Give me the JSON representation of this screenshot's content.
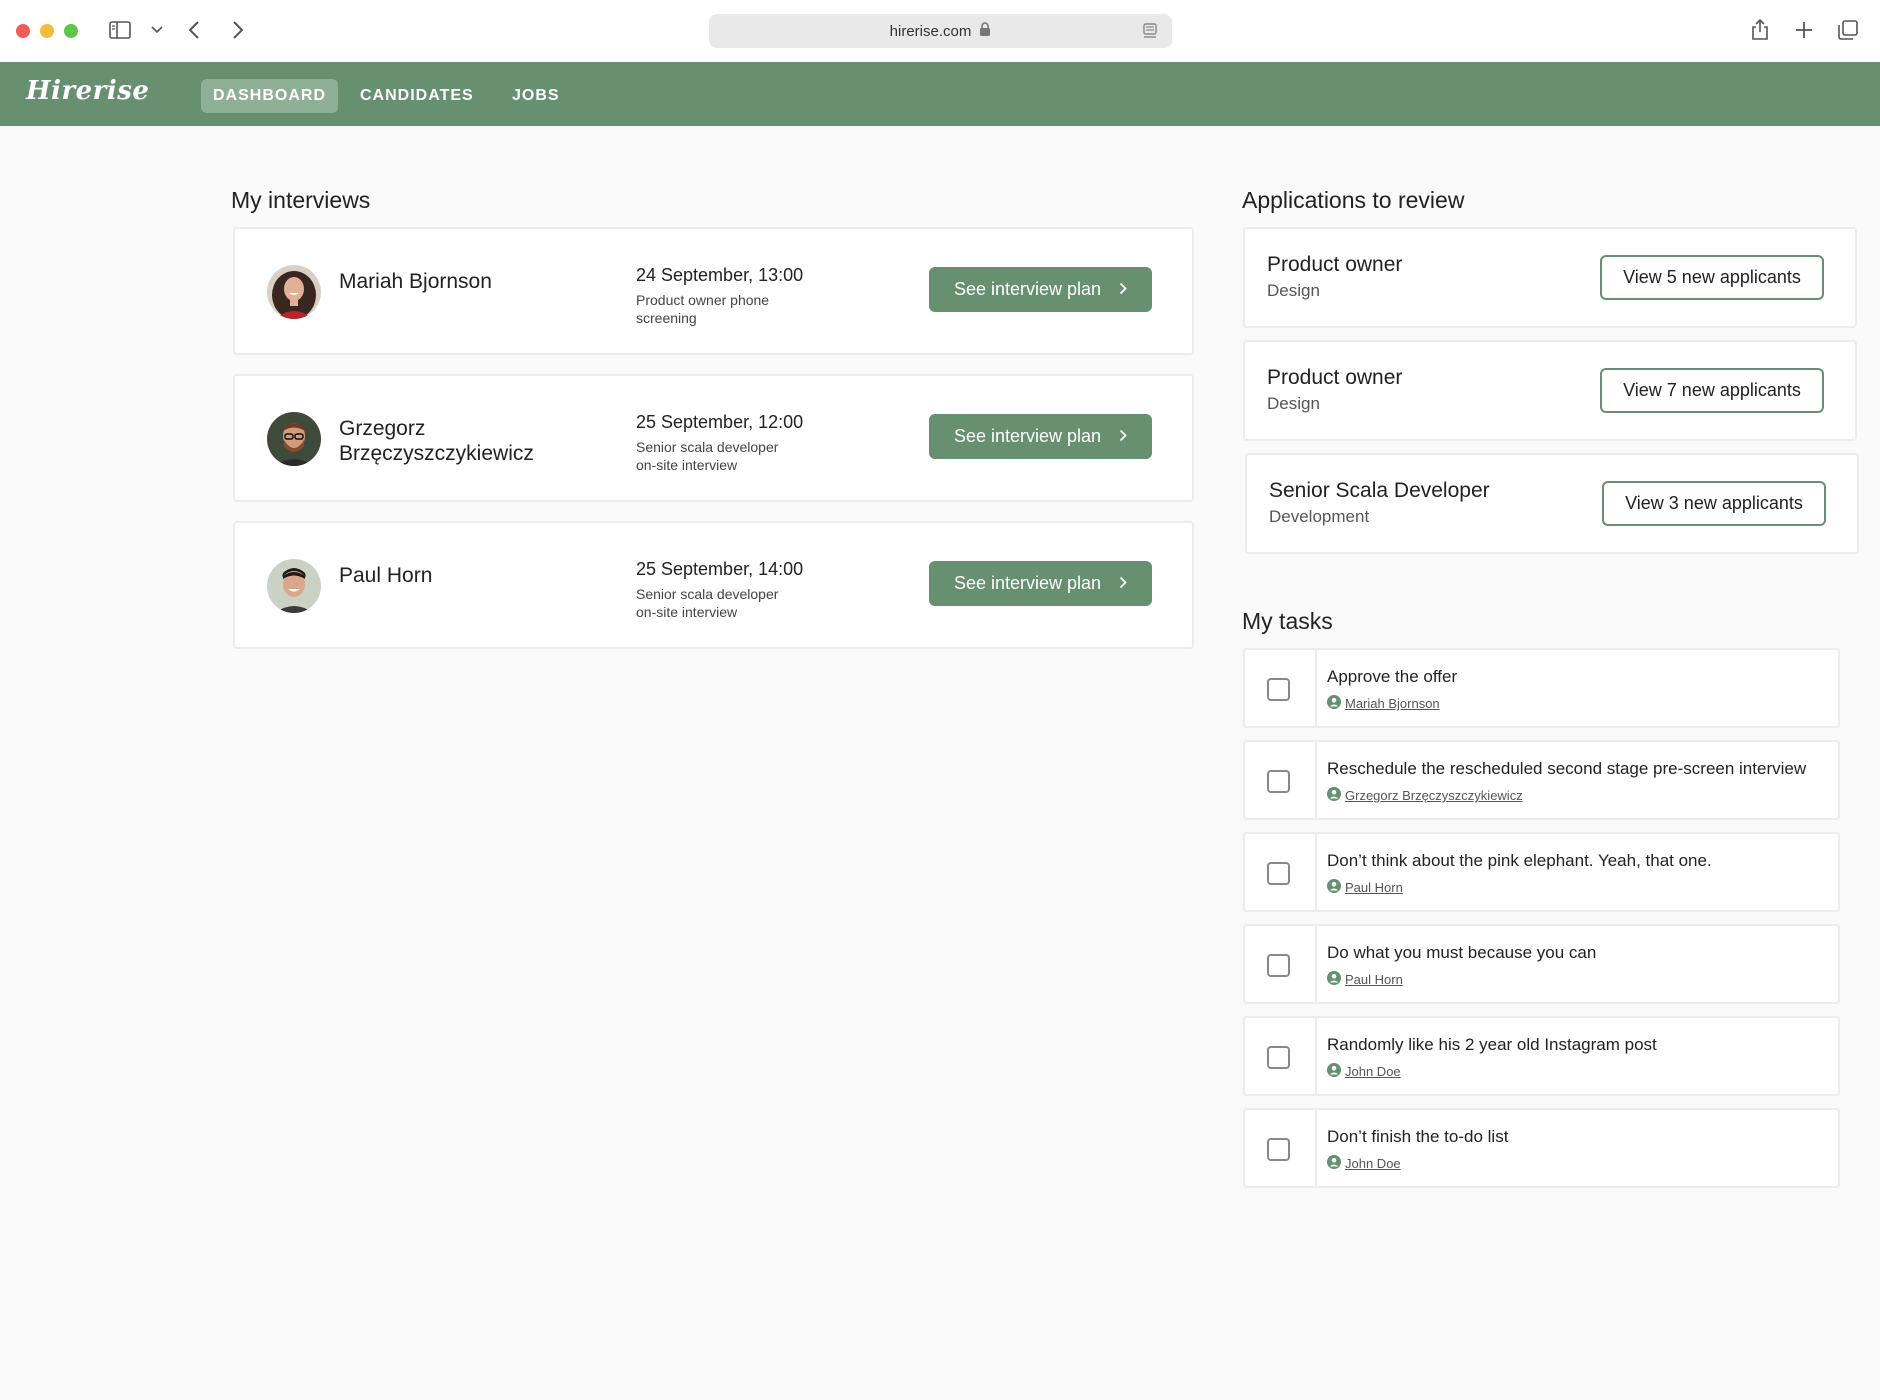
{
  "browser": {
    "url": "hirerise.com"
  },
  "app": {
    "logo": "Hirerise",
    "nav": {
      "dashboard": "DASHBOARD",
      "candidates": "CANDIDATES",
      "jobs": "JOBS"
    }
  },
  "interviews": {
    "title": "My interviews",
    "items": [
      {
        "name_line1": "Mariah Bjornson",
        "name_line2": "",
        "date": "24 September, 13:00",
        "desc_line1": "Product owner phone",
        "desc_line2": "screening",
        "button": "See interview plan"
      },
      {
        "name_line1": "Grzegorz",
        "name_line2": "Brzęczyszczykiewicz",
        "date": "25 September, 12:00",
        "desc_line1": "Senior scala developer",
        "desc_line2": "on-site interview",
        "button": "See interview plan"
      },
      {
        "name_line1": "Paul Horn",
        "name_line2": "",
        "date": "25 September, 14:00",
        "desc_line1": "Senior scala developer",
        "desc_line2": "on-site interview",
        "button": "See interview plan"
      }
    ]
  },
  "applications": {
    "title": "Applications to review",
    "items": [
      {
        "title": "Product owner",
        "dept": "Design",
        "button": "View 5 new applicants"
      },
      {
        "title": "Product owner",
        "dept": "Design",
        "button": "View 7 new applicants"
      },
      {
        "title": "Senior Scala Developer",
        "dept": "Development",
        "button": "View 3 new applicants"
      }
    ]
  },
  "tasks": {
    "title": "My tasks",
    "items": [
      {
        "text": "Approve the offer",
        "owner": "Mariah Bjornson"
      },
      {
        "text": "Reschedule the rescheduled second stage pre-screen interview",
        "owner": "Grzegorz Brzęczyszczykiewicz"
      },
      {
        "text": "Don’t think about the pink elephant. Yeah, that one.",
        "owner": "Paul Horn"
      },
      {
        "text": "Do what you must because you can",
        "owner": "Paul Horn"
      },
      {
        "text": "Randomly like his 2 year old Instagram post",
        "owner": "John Doe"
      },
      {
        "text": "Don’t finish the to-do list",
        "owner": "John Doe"
      }
    ]
  },
  "colors": {
    "brand": "#66906f",
    "background": "#fafafa"
  }
}
